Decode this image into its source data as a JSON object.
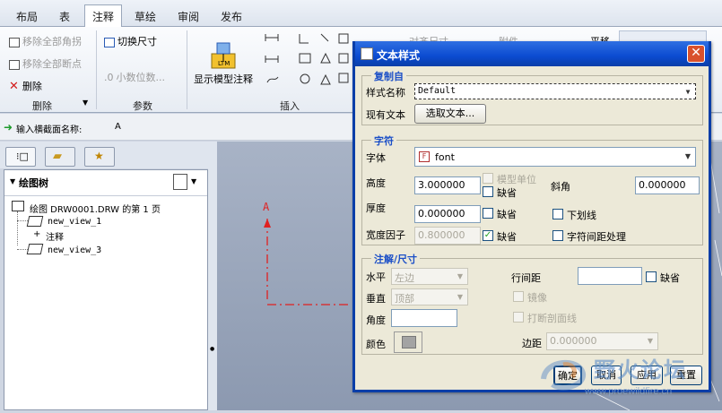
{
  "ribbon": {
    "tabs": [
      "布局",
      "表",
      "注释",
      "草绘",
      "审阅",
      "发布"
    ],
    "active_tab": "注释",
    "delete_group": {
      "items": [
        "移除全部角拐",
        "移除全部断点",
        "删除"
      ],
      "label": "删除"
    },
    "params_group": {
      "items": [
        "切换尺寸",
        "小数位数..."
      ],
      "label": "参数"
    },
    "insert_group": {
      "show_model_annotation": "显示模型注释",
      "label": "插入"
    },
    "right_partial": {
      "item1": "对齐尺寸",
      "item2": "附件",
      "item3": "平移"
    }
  },
  "prompt": {
    "text": "输入横截面名称:",
    "value": "A"
  },
  "tree": {
    "title": "绘图树",
    "root": "绘图 DRW0001.DRW 的第 1 页",
    "items": [
      "new_view_1",
      "注释",
      "new_view_3"
    ]
  },
  "canvas": {
    "section_label": "A"
  },
  "dialog": {
    "title": "文本样式",
    "copy_from": {
      "legend": "复制自",
      "style_name_label": "样式名称",
      "style_name_value": "Default",
      "existing_text_label": "现有文本",
      "select_text_button": "选取文本..."
    },
    "char": {
      "legend": "字符",
      "font_label": "字体",
      "font_value": "font",
      "height_label": "高度",
      "height_value": "3.000000",
      "model_units": "模型单位",
      "default_label": "缺省",
      "slant_label": "斜角",
      "slant_value": "0.000000",
      "thickness_label": "厚度",
      "thickness_value": "0.000000",
      "underline_label": "下划线",
      "width_factor_label": "宽度因子",
      "width_factor_value": "0.800000",
      "kerning_label": "字符间距处理"
    },
    "note": {
      "legend": "注解/尺寸",
      "horizontal_label": "水平",
      "horizontal_value": "左边",
      "vertical_label": "垂直",
      "vertical_value": "顶部",
      "angle_label": "角度",
      "color_label": "颜色",
      "line_spacing_label": "行间距",
      "default_label": "缺省",
      "mirror_label": "镜像",
      "break_hatch_label": "打断剖面线",
      "margin_label": "边距",
      "margin_value": "0.000000"
    },
    "buttons": {
      "ok": "确定",
      "cancel": "取消",
      "apply": "应用",
      "reset": "重置"
    }
  },
  "watermark": {
    "title": "野火论坛",
    "url": "www.proewildfire.cn"
  }
}
